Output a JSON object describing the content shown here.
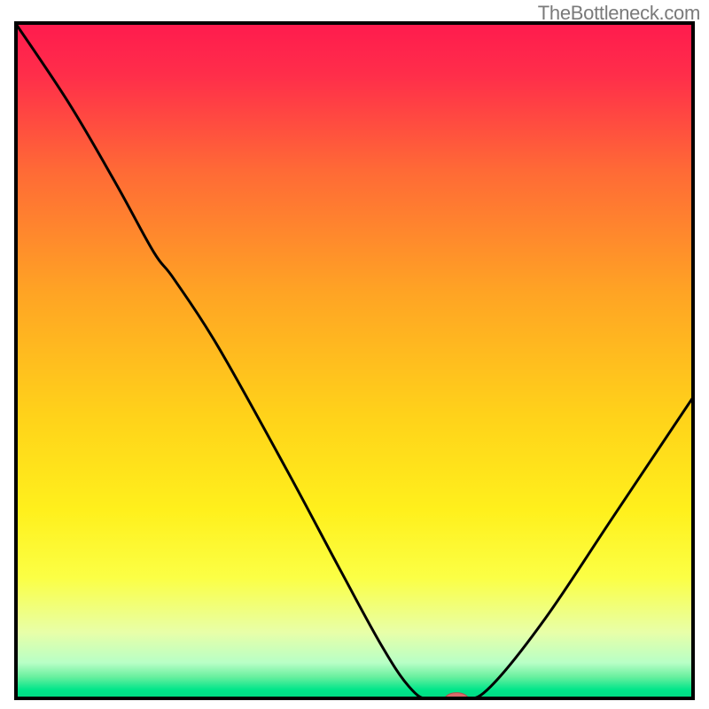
{
  "watermark": "TheBottleneck.com",
  "chart_data": {
    "type": "line",
    "title": "",
    "xlabel": "",
    "ylabel": "",
    "xlim": [
      0,
      100
    ],
    "ylim": [
      0,
      100
    ],
    "gradient_stops": [
      {
        "offset": 0.0,
        "color": "#ff1a4e"
      },
      {
        "offset": 0.08,
        "color": "#ff2e4a"
      },
      {
        "offset": 0.22,
        "color": "#ff6a36"
      },
      {
        "offset": 0.4,
        "color": "#ffa424"
      },
      {
        "offset": 0.58,
        "color": "#ffd21a"
      },
      {
        "offset": 0.72,
        "color": "#fff01c"
      },
      {
        "offset": 0.82,
        "color": "#fbff45"
      },
      {
        "offset": 0.9,
        "color": "#e8ffa8"
      },
      {
        "offset": 0.945,
        "color": "#b8ffc6"
      },
      {
        "offset": 0.965,
        "color": "#6cf0a0"
      },
      {
        "offset": 0.985,
        "color": "#00e58a"
      },
      {
        "offset": 1.0,
        "color": "#00d680"
      }
    ],
    "series": [
      {
        "name": "bottleneck-curve",
        "points": [
          {
            "x": 0.0,
            "y": 100.0
          },
          {
            "x": 8.0,
            "y": 88.0
          },
          {
            "x": 15.0,
            "y": 76.0
          },
          {
            "x": 20.5,
            "y": 66.0
          },
          {
            "x": 23.5,
            "y": 62.0
          },
          {
            "x": 30.0,
            "y": 52.0
          },
          {
            "x": 40.0,
            "y": 34.0
          },
          {
            "x": 48.0,
            "y": 19.0
          },
          {
            "x": 54.0,
            "y": 8.0
          },
          {
            "x": 58.0,
            "y": 2.0
          },
          {
            "x": 61.0,
            "y": 0.0
          },
          {
            "x": 66.0,
            "y": 0.0
          },
          {
            "x": 70.0,
            "y": 2.0
          },
          {
            "x": 78.0,
            "y": 12.0
          },
          {
            "x": 88.0,
            "y": 27.0
          },
          {
            "x": 100.0,
            "y": 45.0
          }
        ]
      }
    ],
    "marker": {
      "x": 65.0,
      "y": 0.0,
      "color": "#d96a6a",
      "rx": 1.8,
      "ry": 1.1
    }
  }
}
